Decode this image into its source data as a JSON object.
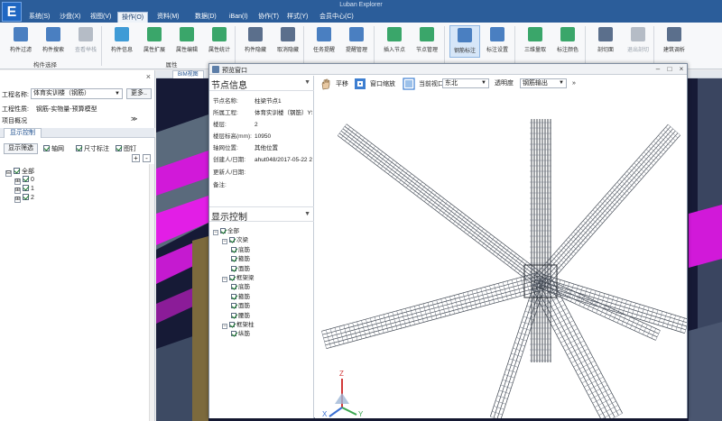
{
  "app": {
    "title": "Luban Explorer",
    "logo_glyph": "E"
  },
  "menu": [
    {
      "label": "系统(S)",
      "active": false
    },
    {
      "label": "沙盘(X)",
      "active": false
    },
    {
      "label": "视图(V)",
      "active": false
    },
    {
      "label": "操作(O)",
      "active": true
    },
    {
      "label": "资料(M)",
      "active": false
    },
    {
      "label": "数据(D)",
      "active": false
    },
    {
      "label": "iBan(I)",
      "active": false
    },
    {
      "label": "协作(T)",
      "active": false
    },
    {
      "label": "样式(Y)",
      "active": false
    },
    {
      "label": "会员中心(C)",
      "active": false
    }
  ],
  "ribbon": {
    "buttons": [
      {
        "label": "构件过滤",
        "icon": "filter-icon",
        "color": "#4a7fc1",
        "disabled": false,
        "selected": false
      },
      {
        "label": "构件搜索",
        "icon": "search-icon",
        "color": "#4a7fc1",
        "disabled": false,
        "selected": false
      },
      {
        "label": "查看举栈",
        "icon": "stack-icon",
        "color": "#b5bcc6",
        "disabled": true,
        "selected": false
      },
      {
        "label": "构件信息",
        "icon": "info-icon",
        "color": "#3f9bd6",
        "disabled": false,
        "selected": false
      },
      {
        "label": "属性扩展",
        "icon": "attribute-extend-icon",
        "color": "#3aa66a",
        "disabled": false,
        "selected": false
      },
      {
        "label": "属性编辑",
        "icon": "attribute-edit-icon",
        "color": "#3aa66a",
        "disabled": false,
        "selected": false
      },
      {
        "label": "属性统计",
        "icon": "attribute-stats-icon",
        "color": "#3aa66a",
        "disabled": false,
        "selected": false
      },
      {
        "label": "构件隐藏",
        "icon": "hide-icon",
        "color": "#5b6f8c",
        "disabled": false,
        "selected": false
      },
      {
        "label": "取消隐藏",
        "icon": "unhide-icon",
        "color": "#5b6f8c",
        "disabled": false,
        "selected": false
      },
      {
        "label": "任务提醒",
        "icon": "bell-icon",
        "color": "#4a7fc1",
        "disabled": false,
        "selected": false
      },
      {
        "label": "提醒管理",
        "icon": "reminder-manage-icon",
        "color": "#4a7fc1",
        "disabled": false,
        "selected": false
      },
      {
        "label": "插入节点",
        "icon": "insert-node-icon",
        "color": "#3aa66a",
        "disabled": false,
        "selected": false
      },
      {
        "label": "节点管理",
        "icon": "node-manage-icon",
        "color": "#3aa66a",
        "disabled": false,
        "selected": false
      },
      {
        "label": "钢筋标注",
        "icon": "rebar-tag-icon",
        "color": "#4a7fc1",
        "disabled": false,
        "selected": true
      },
      {
        "label": "标注设置",
        "icon": "tag-settings-icon",
        "color": "#4a7fc1",
        "disabled": false,
        "selected": false
      },
      {
        "label": "三维量取",
        "icon": "measure-3d-icon",
        "color": "#3aa66a",
        "disabled": false,
        "selected": false
      },
      {
        "label": "标注颜色",
        "icon": "tag-color-icon",
        "color": "#3aa66a",
        "disabled": false,
        "selected": false
      },
      {
        "label": "剖切面",
        "icon": "section-plane-icon",
        "color": "#5b6f8c",
        "disabled": false,
        "selected": false
      },
      {
        "label": "退出剖切",
        "icon": "exit-section-icon",
        "color": "#b5bcc6",
        "disabled": true,
        "selected": false
      },
      {
        "label": "建筑调析",
        "icon": "building-analysis-icon",
        "color": "#5b6f8c",
        "disabled": false,
        "selected": false
      }
    ],
    "groups": [
      {
        "label": "构件选择"
      },
      {
        "label": "属性"
      }
    ]
  },
  "left_panel": {
    "project_label": "工程名称:",
    "project_value": "体育实训楼（钢筋）",
    "more_label": "更多..",
    "property_label": "工程性质:",
    "property_value": "钢筋-实物量-预算模型",
    "section_label": "项目概况",
    "section_arrow": "≫",
    "tab_label": "显示控制",
    "filter_button": "显示筛选",
    "checks": [
      {
        "label": "轴网",
        "checked": true
      },
      {
        "label": "尺寸标注",
        "checked": true
      },
      {
        "label": "图钉",
        "checked": true
      }
    ],
    "tree": [
      {
        "label": "全部",
        "level": 0,
        "expander": "⊟"
      },
      {
        "label": "0",
        "level": 1,
        "expander": "⊞"
      },
      {
        "label": "1",
        "level": 1,
        "expander": "⊞"
      },
      {
        "label": "2",
        "level": 1,
        "expander": "⊞"
      }
    ]
  },
  "view": {
    "tab_label": "BIM视图"
  },
  "preview": {
    "title": "预览窗口",
    "toolbar": {
      "pan_label": "平移",
      "zoom_window_label": "窗口缩放",
      "current_view_label": "当前视口",
      "current_view_value": "东北",
      "transparency_label": "透明度",
      "transparency_value": "钢筋输出"
    },
    "info": {
      "heading": "节点信息",
      "rows": [
        {
          "key": "节点名称:",
          "value": "柱梁节点1"
        },
        {
          "key": "所属工程:",
          "value": "体育实训楼（钢筋）YS"
        },
        {
          "key": "楼层:",
          "value": "2"
        },
        {
          "key": "楼层标高(mm):",
          "value": "10950"
        },
        {
          "key": "轴网位置:",
          "value": "其他位置"
        },
        {
          "key": "创建人/日期:",
          "value": "ahut048/2017-05-22 22:1"
        },
        {
          "key": "更新人/日期:",
          "value": ""
        },
        {
          "key": "备注:",
          "value": ""
        }
      ]
    },
    "display": {
      "heading": "显示控制",
      "tree": [
        {
          "label": "全部",
          "level": 0,
          "has_exp": true
        },
        {
          "label": "次梁",
          "level": 1,
          "has_exp": true
        },
        {
          "label": "底筋",
          "level": 2,
          "has_exp": false
        },
        {
          "label": "箍筋",
          "level": 2,
          "has_exp": false
        },
        {
          "label": "面筋",
          "level": 2,
          "has_exp": false
        },
        {
          "label": "框架梁",
          "level": 1,
          "has_exp": true
        },
        {
          "label": "底筋",
          "level": 2,
          "has_exp": false
        },
        {
          "label": "箍筋",
          "level": 2,
          "has_exp": false
        },
        {
          "label": "面筋",
          "level": 2,
          "has_exp": false
        },
        {
          "label": "腰筋",
          "level": 2,
          "has_exp": false
        },
        {
          "label": "框架柱",
          "level": 1,
          "has_exp": true
        },
        {
          "label": "纵筋",
          "level": 2,
          "has_exp": false
        }
      ]
    },
    "axes": {
      "x": "X",
      "y": "Y",
      "z": "Z"
    }
  }
}
